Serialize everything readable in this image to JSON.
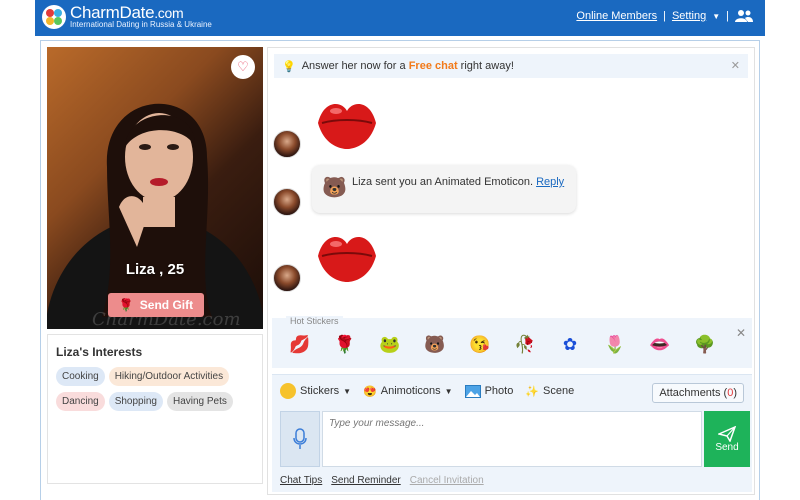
{
  "header": {
    "brand_name": "CharmDate",
    "brand_suffix": ".com",
    "tagline": "International Dating in Russia & Ukraine",
    "online_members": "Online Members",
    "separator": "|",
    "setting": "Setting",
    "colors": {
      "bar": "#1a69c0"
    }
  },
  "profile": {
    "name_age": "Liza , 25",
    "send_gift": "Send Gift",
    "watermark": "CharmDate.com"
  },
  "interests": {
    "title": "Liza's Interests",
    "tags": [
      {
        "label": "Cooking",
        "color": "#dde8f6"
      },
      {
        "label": "Hiking/Outdoor Activities",
        "color": "#fbe8d8"
      },
      {
        "label": "Dancing",
        "color": "#f9dcdc"
      },
      {
        "label": "Shopping",
        "color": "#dde8f6"
      },
      {
        "label": "Having Pets",
        "color": "#e4e4e4"
      }
    ]
  },
  "chat": {
    "notice_pre": "Answer her now for a ",
    "notice_free": "Free chat",
    "notice_post": " right away!",
    "bubble_text": "Liza sent you an Animated Emoticon. ",
    "bubble_link": "Reply"
  },
  "hot_stickers": {
    "label": "Hot Stickers",
    "items": [
      "lips-sticker",
      "rose-sticker",
      "love-you-frog-sticker",
      "love-you-bear-sticker",
      "kiss-face-sticker",
      "red-rose-sticker",
      "blue-rose-sticker",
      "tulips-sticker",
      "lips-pair-sticker",
      "love-tree-sticker"
    ]
  },
  "compose": {
    "stickers": "Stickers",
    "animoticons": "Animoticons",
    "photo": "Photo",
    "scene": "Scene",
    "attachments": "Attachments (",
    "attachments_count": "0",
    "attachments_close": ")",
    "placeholder": "Type your message...",
    "send": "Send",
    "chat_tips": "Chat Tips",
    "send_reminder": "Send Reminder",
    "cancel_invitation": "Cancel Invitation"
  }
}
